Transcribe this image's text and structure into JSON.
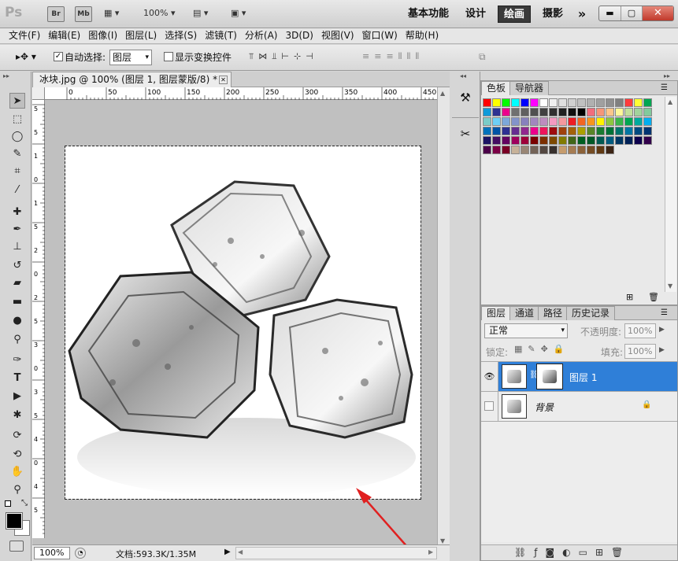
{
  "appbar": {
    "logo": "Ps",
    "br": "Br",
    "mb": "Mb",
    "zoom": "100%",
    "workspaces": [
      "基本功能",
      "设计",
      "绘画",
      "摄影"
    ],
    "more": "»"
  },
  "menu": [
    "文件(F)",
    "编辑(E)",
    "图像(I)",
    "图层(L)",
    "选择(S)",
    "滤镜(T)",
    "分析(A)",
    "3D(D)",
    "视图(V)",
    "窗口(W)",
    "帮助(H)"
  ],
  "options": {
    "auto_select_label": "自动选择:",
    "auto_select_value": "图层",
    "show_transform_label": "显示变换控件",
    "auto_select_checked": true,
    "show_transform_checked": false
  },
  "document": {
    "tab_title": "冰块.jpg @ 100% (图层 1, 图层蒙版/8) *",
    "ruler_ticks": [
      "0",
      "50",
      "100",
      "150",
      "200",
      "250",
      "300",
      "350",
      "400",
      "450"
    ],
    "zoom": "100%",
    "status": "文档:593.3K/1.35M",
    "v_ruler_ticks": [
      "5",
      "5",
      "1",
      "0",
      "1",
      "5",
      "2",
      "0",
      "2",
      "5",
      "3",
      "0",
      "3",
      "5",
      "4",
      "0",
      "4",
      "5"
    ]
  },
  "swatches_panel": {
    "tabs": [
      "色板",
      "导航器"
    ],
    "colors": [
      "#ff0000",
      "#ffff00",
      "#00ff00",
      "#00ffff",
      "#0000ff",
      "#ff00ff",
      "#ffffff",
      "#f0f0f0",
      "#e0e0e0",
      "#d0d0d0",
      "#c0c0c0",
      "#b0b0b0",
      "#a0a0a0",
      "#909090",
      "#808080",
      "#ff3b3b",
      "#ffff33",
      "#00a651",
      "#0f9ad9",
      "#2e3192",
      "#ec008c",
      "#707070",
      "#606060",
      "#505050",
      "#404040",
      "#303030",
      "#202020",
      "#101010",
      "#000000",
      "#f26d7d",
      "#f69679",
      "#fdc68a",
      "#fff799",
      "#c4df9b",
      "#a3d39c",
      "#82ca9c",
      "#7accc8",
      "#6dcff6",
      "#7da7d9",
      "#8393ca",
      "#8781bd",
      "#a187be",
      "#bd8cbf",
      "#f49ac1",
      "#f5989d",
      "#ed1c24",
      "#f26522",
      "#f7941d",
      "#fff200",
      "#8dc63f",
      "#39b54a",
      "#00a651",
      "#00a99d",
      "#00aeef",
      "#0072bc",
      "#0054a6",
      "#2e3192",
      "#662d91",
      "#92278f",
      "#ec008c",
      "#ed145b",
      "#9e0b0f",
      "#a0410d",
      "#a36209",
      "#aba000",
      "#598527",
      "#197b30",
      "#007236",
      "#00746b",
      "#0076a3",
      "#004b80",
      "#003471",
      "#1b1464",
      "#440e62",
      "#630460",
      "#9e005d",
      "#9e0039",
      "#790000",
      "#7b2e00",
      "#7d4900",
      "#827b00",
      "#406618",
      "#005e20",
      "#005826",
      "#005952",
      "#005b7f",
      "#003663",
      "#002157",
      "#0d004c",
      "#32004b",
      "#4b0049",
      "#7b0046",
      "#7a0026",
      "#c7b299",
      "#998675",
      "#736357",
      "#534741",
      "#37302d",
      "#c69c6d",
      "#a67c52",
      "#8c6239",
      "#754c24",
      "#603913",
      "#3c2415"
    ]
  },
  "layers_panel": {
    "tabs": [
      "图层",
      "通道",
      "路径",
      "历史记录"
    ],
    "blend_mode": "正常",
    "opacity_label": "不透明度:",
    "opacity_value": "100%",
    "lock_label": "锁定:",
    "fill_label": "填充:",
    "fill_value": "100%",
    "layers": [
      {
        "name": "图层 1",
        "selected": true,
        "visible": true,
        "has_mask": true
      },
      {
        "name": "背景",
        "selected": false,
        "visible": false,
        "locked": true
      }
    ]
  }
}
